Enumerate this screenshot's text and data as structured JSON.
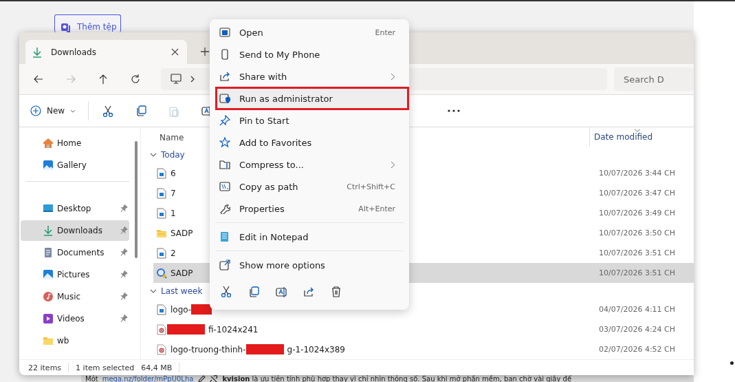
{
  "background_button": {
    "label": "Thêm tệp"
  },
  "explorer": {
    "tabs": [
      {
        "label": "Downloads",
        "selected": true
      }
    ],
    "search": {
      "placeholder": "Search D"
    },
    "toolbar": {
      "new_label": "New"
    },
    "sidebar": {
      "items": [
        {
          "label": "Home",
          "selected": false,
          "pinned": false
        },
        {
          "label": "Gallery",
          "selected": false,
          "pinned": false
        },
        {
          "label": "Desktop",
          "selected": false,
          "pinned": true
        },
        {
          "label": "Downloads",
          "selected": true,
          "pinned": true
        },
        {
          "label": "Documents",
          "selected": false,
          "pinned": true
        },
        {
          "label": "Pictures",
          "selected": false,
          "pinned": true
        },
        {
          "label": "Music",
          "selected": false,
          "pinned": true
        },
        {
          "label": "Videos",
          "selected": false,
          "pinned": true
        },
        {
          "label": "wb",
          "selected": false,
          "pinned": false
        }
      ]
    },
    "columns": [
      "Name",
      "Date modified"
    ],
    "groups": [
      {
        "label": "Today",
        "expanded": true,
        "rows": [
          {
            "kind": "image",
            "name_parts": [
              {
                "kind": "text",
                "text": "6"
              }
            ],
            "date": "10/07/2026 3:44 CH",
            "selected": false
          },
          {
            "kind": "image",
            "name_parts": [
              {
                "kind": "text",
                "text": "7"
              }
            ],
            "date": "10/07/2026 3:47 CH",
            "selected": false
          },
          {
            "kind": "image",
            "name_parts": [
              {
                "kind": "text",
                "text": "1"
              }
            ],
            "date": "10/07/2026 3:49 CH",
            "selected": false
          },
          {
            "kind": "zip",
            "name_parts": [
              {
                "kind": "text",
                "text": "SADP"
              }
            ],
            "date": "10/07/2026 3:50 CH",
            "selected": false
          },
          {
            "kind": "image",
            "name_parts": [
              {
                "kind": "text",
                "text": "2"
              }
            ],
            "date": "10/07/2026 3:51 CH",
            "selected": false
          },
          {
            "kind": "app",
            "name_parts": [
              {
                "kind": "text",
                "text": "SADP"
              }
            ],
            "date": "10/07/2026 3:51 CH",
            "selected": true
          }
        ]
      },
      {
        "label": "Last week",
        "expanded": true,
        "rows": [
          {
            "kind": "image",
            "name_parts": [
              {
                "kind": "text",
                "text": "logo-"
              },
              {
                "kind": "redacted_short"
              }
            ],
            "date": "04/07/2026 4:11 CH",
            "selected": false
          },
          {
            "kind": "web",
            "name_parts": [
              {
                "kind": "redacted_long"
              },
              {
                "kind": "text",
                "text": "fi-1024x241"
              }
            ],
            "date": "03/07/2026 4:24 CH",
            "selected": false
          },
          {
            "kind": "web",
            "name_parts": [
              {
                "kind": "text",
                "text": "logo-truong-thinh-"
              },
              {
                "kind": "redacted_long"
              },
              {
                "kind": "text",
                "text": "g-1-1024x389"
              }
            ],
            "date": "02/07/2026 4:52 CH",
            "selected": false
          }
        ]
      }
    ],
    "status": {
      "count": "22 items",
      "selection": "1 item selected",
      "size": "64,4 MB"
    }
  },
  "context_menu": {
    "items": [
      {
        "kind": "item",
        "label": "Open",
        "shortcut": "Enter",
        "submenu": false,
        "highlighted": false
      },
      {
        "kind": "item",
        "label": "Send to My Phone",
        "submenu": false,
        "highlighted": false
      },
      {
        "kind": "item",
        "label": "Share with",
        "submenu": true,
        "highlighted": false
      },
      {
        "kind": "item",
        "label": "Run as administrator",
        "submenu": false,
        "highlighted": true
      },
      {
        "kind": "item",
        "label": "Pin to Start",
        "submenu": false,
        "highlighted": false
      },
      {
        "kind": "item",
        "label": "Add to Favorites",
        "submenu": false,
        "highlighted": false
      },
      {
        "kind": "item",
        "label": "Compress to...",
        "submenu": true,
        "highlighted": false
      },
      {
        "kind": "item",
        "label": "Copy as path",
        "shortcut": "Ctrl+Shift+C",
        "submenu": false,
        "highlighted": false
      },
      {
        "kind": "item",
        "label": "Properties",
        "shortcut": "Alt+Enter",
        "submenu": false,
        "highlighted": false
      },
      {
        "kind": "separator"
      },
      {
        "kind": "item",
        "label": "Edit in Notepad",
        "submenu": false,
        "highlighted": false
      },
      {
        "kind": "separator"
      },
      {
        "kind": "item",
        "label": "Show more options",
        "submenu": false,
        "highlighted": false
      },
      {
        "kind": "icons"
      }
    ]
  },
  "article_strip": {
    "lead": "Một",
    "link": "mega.nz/folder/mPpU0Lha",
    "text": "**kvision** là ưu tiên tính phù hợp thay vì chỉ nhìn thông số. Sau khi mở phần mềm, bạn chờ vài giây để"
  }
}
